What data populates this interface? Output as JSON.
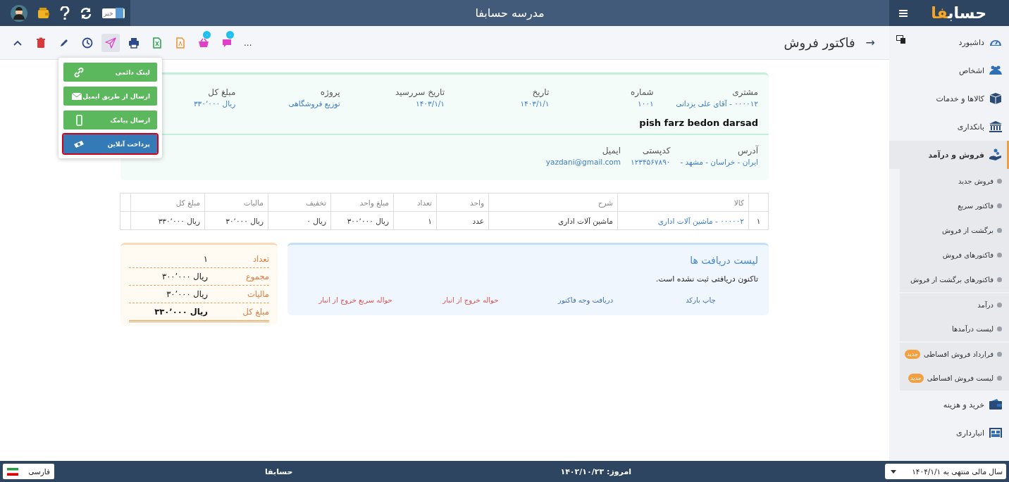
{
  "top_bar": {
    "logo": {
      "text": "حساب",
      "accent": "فا"
    },
    "title": "مدرسه حسابفا",
    "news_label": "خبر"
  },
  "toolbar": {
    "back": "→",
    "title": "فاکتور فروش",
    "more": "...",
    "buttons": [
      {
        "badge": "۰",
        "selected": false
      },
      {
        "badge": "۰",
        "selected": false
      },
      {
        "selected": false
      },
      {
        "selected": false
      },
      {
        "selected": false
      },
      {
        "selected": true
      },
      {
        "selected": false
      },
      {
        "selected": false
      },
      {
        "selected": false
      },
      {
        "selected": false
      }
    ]
  },
  "send_menu": {
    "items": [
      {
        "label": "لینک دائمی",
        "selected": false
      },
      {
        "label": "ارسال از طریق ایمیل",
        "selected": false
      },
      {
        "label": "ارسال پیامک",
        "selected": false
      },
      {
        "label": "پرداخت آنلاین",
        "selected": true
      }
    ]
  },
  "invoice": {
    "fields": [
      {
        "label": "مشتری",
        "value": "۰۰۰۰۱۲ - آقای علی یزدانی"
      },
      {
        "label": "شماره",
        "value": "۱۰۰۱"
      },
      {
        "label": "تاریخ",
        "value": "۱۴۰۳/۱/۱"
      },
      {
        "label": "تاریخ سررسید",
        "value": "۱۴۰۳/۱/۱"
      },
      {
        "label": "پروژه",
        "value": "توزیع فروشگاهی"
      },
      {
        "label": "مبلغ کل",
        "value": "ریال ۳۳۰٬۰۰۰"
      }
    ],
    "note": "pish farz bedon darsad",
    "contact": [
      {
        "label": "آدرس",
        "value": "ایران - خراسان - مشهد -"
      },
      {
        "label": "کدپستی",
        "value": "۱۲۳۴۵۶۷۸۹۰"
      },
      {
        "label": "ایمیل",
        "value": "yazdani@gmail.com"
      }
    ]
  },
  "table": {
    "columns": [
      "کالا",
      "شرح",
      "واحد",
      "تعداد",
      "مبلغ واحد",
      "تخفیف",
      "مالیات",
      "مبلغ کل"
    ],
    "rows": [
      {
        "index": "۱",
        "cells": [
          "۰۰۰۰۰۲ - ماشین آلات اداری",
          "ماشین آلات اداری",
          "عدد",
          "۱",
          "ریال ۳۰۰٬۰۰۰",
          "ریال ۰",
          "ریال ۳۰٬۰۰۰",
          "ریال ۳۳۰٬۰۰۰"
        ]
      }
    ]
  },
  "receipts": {
    "title": "لیست دریافت ها",
    "message": "تاکنون دریافتی ثبت نشده است.",
    "links": [
      {
        "label": "چاپ بارکد",
        "color": "#3d6fb5"
      },
      {
        "label": "دریافت وجه فاکتور",
        "color": "#3d6fb5"
      },
      {
        "label": "حواله خروج از انبار",
        "color": "#d9534f"
      },
      {
        "label": "حواله سریع خروج از انبار",
        "color": "#d9534f"
      }
    ]
  },
  "summary": [
    {
      "label": "تعداد",
      "value": "۱"
    },
    {
      "label": "مجموع",
      "value": "ریال ۳۰۰٬۰۰۰"
    },
    {
      "label": "مالیات",
      "value": "ریال ۳۰٬۰۰۰"
    },
    {
      "label": "مبلغ کل",
      "value": "ریال ۳۳۰٬۰۰۰"
    }
  ],
  "sidebar": {
    "items": [
      {
        "label": "داشبورد",
        "selected": false
      },
      {
        "label": "اشخاص",
        "selected": false
      },
      {
        "label": "کالاها و خدمات",
        "selected": false
      },
      {
        "label": "بانکداری",
        "selected": false
      },
      {
        "label": "فروش و درآمد",
        "selected": true,
        "children": [
          {
            "label": "فروش جدید",
            "divider_before": false
          },
          {
            "label": "فاکتور سریع",
            "divider_before": false
          },
          {
            "label": "برگشت از فروش",
            "divider_before": false
          },
          {
            "label": "فاکتورهای فروش",
            "divider_before": false
          },
          {
            "label": "فاکتورهای برگشت از فروش",
            "divider_before": false
          },
          {
            "label": "درآمد",
            "divider_before": true
          },
          {
            "label": "لیست درآمدها",
            "divider_before": false
          },
          {
            "label": "قرارداد فروش اقساطی",
            "badge": "جدید",
            "divider_before": true
          },
          {
            "label": "لیست فروش اقساطی",
            "badge": "جدید",
            "divider_before": false
          }
        ]
      },
      {
        "label": "خرید و هزینه",
        "selected": false
      },
      {
        "label": "انبارداری",
        "selected": false
      }
    ]
  },
  "status_bar": {
    "fiscal_year": "سال مالی منتهی به ۱۴۰۴/۱/۱",
    "today": "امروز: ۱۴۰۲/۱۰/۲۳",
    "app_name": "حسابفا",
    "language": "فارسی"
  }
}
